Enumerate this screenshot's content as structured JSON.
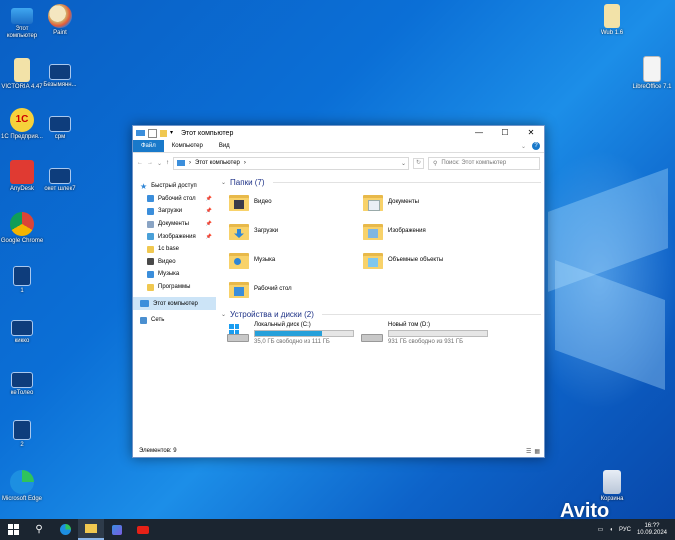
{
  "desktop": {
    "icons": [
      {
        "label": "Этот компьютер",
        "icon": "this-pc-icon"
      },
      {
        "label": "Paint",
        "icon": "paint-icon"
      },
      {
        "label": "VICTORIA 4.47",
        "icon": "file-icon"
      },
      {
        "label": "Безымянн...",
        "icon": "shortcut-icon"
      },
      {
        "label": "1С Предприя...",
        "icon": "1c-icon"
      },
      {
        "label": "срм",
        "icon": "shortcut-icon"
      },
      {
        "label": "AnyDesk",
        "icon": "anydesk-icon"
      },
      {
        "label": "окет шлек7",
        "icon": "shortcut-icon"
      },
      {
        "label": "Google Chrome",
        "icon": "chrome-icon"
      },
      {
        "label": "1",
        "icon": "shortcut-icon"
      },
      {
        "label": "кикко",
        "icon": "shortcut-icon"
      },
      {
        "label": "кеТолео",
        "icon": "shortcut-icon"
      },
      {
        "label": "2",
        "icon": "shortcut-icon"
      },
      {
        "label": "Microsoft Edge",
        "icon": "edge-icon"
      },
      {
        "label": "Wub 1.6",
        "icon": "file-icon"
      },
      {
        "label": "LibreOffice 7.1",
        "icon": "libreoffice-icon"
      },
      {
        "label": "Корзина",
        "icon": "recycle-bin-icon"
      }
    ]
  },
  "window": {
    "title": "Этот компьютер",
    "controls": {
      "minimize": "—",
      "maximize": "☐",
      "close": "✕"
    },
    "ribbon": {
      "file": "Файл",
      "computer": "Компьютер",
      "view": "Вид"
    },
    "address": {
      "path": "Этот компьютер",
      "chevron": "›"
    },
    "search": {
      "placeholder": "Поиск: Этот компьютер"
    },
    "nav": {
      "quick_access": "Быстрый доступ",
      "items": [
        {
          "label": "Рабочий стол",
          "pinned": true,
          "color": "#3b8edb"
        },
        {
          "label": "Загрузки",
          "pinned": true,
          "color": "#3b8edb"
        },
        {
          "label": "Документы",
          "pinned": true,
          "color": "#8aa4c4"
        },
        {
          "label": "Изображения",
          "pinned": true,
          "color": "#4aa0d8"
        },
        {
          "label": "1c base",
          "pinned": false,
          "color": "#f0c850"
        },
        {
          "label": "Видео",
          "pinned": false,
          "color": "#4a4a4a"
        },
        {
          "label": "Музыка",
          "pinned": false,
          "color": "#3b8edb"
        },
        {
          "label": "Программы",
          "pinned": false,
          "color": "#f0c850"
        }
      ],
      "this_pc": "Этот компьютер",
      "network": "Сеть"
    },
    "folders_header": "Папки (7)",
    "folders": [
      {
        "label": "Видео",
        "emblem": "#3a3a4a"
      },
      {
        "label": "Документы",
        "emblem": "#e9eef5"
      },
      {
        "label": "Загрузки",
        "emblem": "#2f86d6"
      },
      {
        "label": "Изображения",
        "emblem": "#7fb6e2"
      },
      {
        "label": "Музыка",
        "emblem": "#2f86d6"
      },
      {
        "label": "Объемные объекты",
        "emblem": "#7fc7ee"
      },
      {
        "label": "Рабочий стол",
        "emblem": "#3b8edb"
      }
    ],
    "drives_header": "Устройства и диски (2)",
    "drives": [
      {
        "label": "Локальный диск (C:)",
        "free": "35,0 ГБ свободно из 111 ГБ",
        "used_fraction": 0.685
      },
      {
        "label": "Новый том (D:)",
        "free": "931 ГБ свободно из 931 ГБ",
        "used_fraction": 0.0
      }
    ],
    "status": "Элементов: 9"
  },
  "taskbar": {
    "lang": "РУС",
    "time": "16:??",
    "date": "10.09.2024"
  },
  "watermark": "Avito",
  "colors": {
    "accent": "#1979ca",
    "header": "#1e3287",
    "drive_fill": "#26a0da"
  }
}
